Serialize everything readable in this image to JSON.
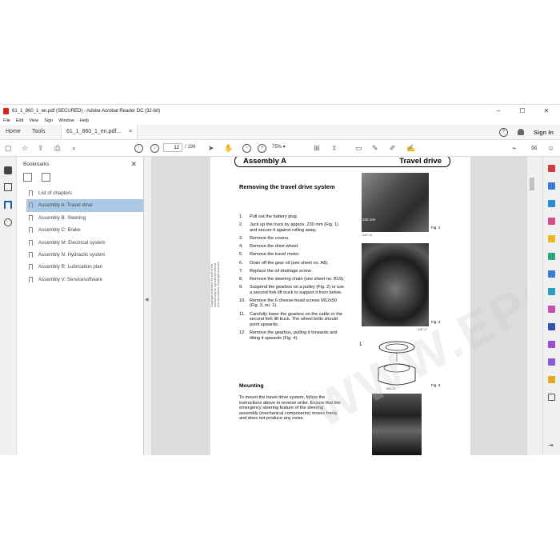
{
  "window": {
    "title": "61_1_860_1_en.pdf (SECURED) - Adobe Acrobat Reader DC (32-bit)",
    "controls": [
      "–",
      "☐",
      "✕"
    ]
  },
  "menu": [
    "File",
    "Edit",
    "View",
    "Sign",
    "Window",
    "Help"
  ],
  "tabs": {
    "home": "Home",
    "tools": "Tools",
    "document": "61_1_860_1_en.pdf...",
    "close": "×",
    "help": "?",
    "signin": "Sign In"
  },
  "toolbar": {
    "current_page": "12",
    "total_pages": "/ 199",
    "zoom": "75%"
  },
  "bookmarks": {
    "title": "Bookmarks",
    "close": "✕",
    "items": [
      {
        "label": "List of chapters"
      },
      {
        "label": "Assembly A: Travel drive"
      },
      {
        "label": "Assembly B: Steering"
      },
      {
        "label": "Assembly C: Brake"
      },
      {
        "label": "Assembly M: Electrical system"
      },
      {
        "label": "Assembly N: Hydraulic system"
      },
      {
        "label": "Assembly R: Lubrication plan"
      },
      {
        "label": "Assembly V: Servicesoftware"
      }
    ],
    "selected_index": 1
  },
  "document": {
    "header_left": "Assembly  A",
    "header_right": "Travel drive",
    "section_title": "Removing the travel drive system",
    "steps": [
      {
        "n": "1.",
        "text": "Pull out the battery plug."
      },
      {
        "n": "2.",
        "text": "Jack up the truck by approx. 230 mm (Fig. 1) and secure it against rolling away."
      },
      {
        "n": "3.",
        "text": "Remove the covers."
      },
      {
        "n": "4.",
        "text": "Remove the drive wheel."
      },
      {
        "n": "5.",
        "text": "Remove the travel motor."
      },
      {
        "n": "6.",
        "text": "Drain off the gear oil (see sheet no. A8)."
      },
      {
        "n": "7.",
        "text": "Replace the oil drainage screw."
      },
      {
        "n": "8.",
        "text": "Remove the steering chain (see sheet no. B19)."
      },
      {
        "n": "9.",
        "text": "Suspend the gearbox on a pulley (Fig. 2) or use a second fork lift truck to support it from below."
      },
      {
        "n": "10.",
        "text": "Remove the 6 cheese-head screws M12x50 (Fig. 3, no. 1)."
      },
      {
        "n": "11.",
        "text": "Carefully lower the gearbox on the cable or the second fork lift truck. The wheel bolts should point upwards."
      },
      {
        "n": "12.",
        "text": "Remove the gearbox, pulling it forwards and tilting it upwards (Fig. 4)."
      }
    ],
    "mounting_title": "Mounting",
    "mounting_text": "To mount the travel drive system, follow the instructions above in reverse order. Ensure that the emergency steering feature of the steering assembly (mechanical components) moves freely and does not produce any noise.",
    "side_note": "Copyright protected. No part of this manual may be reproduced without prior permission. Copyright reserved.",
    "fig1": "Fig. 1",
    "fig2": "Fig. 2",
    "fig3": "Fig. 3",
    "fig1_code": "3-87.13",
    "fig2_code": "3-87.27",
    "fig3_code": "505-23",
    "measure": "230 mm",
    "callout": "1"
  },
  "watermark": "WWW.EPCATALOGS.COM",
  "colors": {
    "selection": "#a9c9e6",
    "pdf_red": "#d8261b"
  }
}
